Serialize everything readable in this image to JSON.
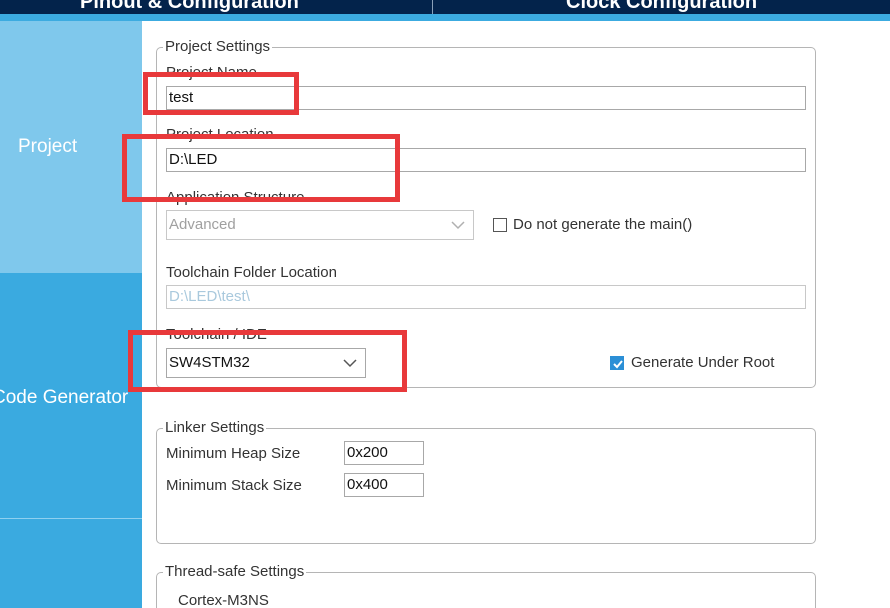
{
  "tabs": {
    "pinout": "Pinout & Configuration",
    "clock": "Clock Configuration"
  },
  "sidebar": {
    "items": [
      {
        "label": "Project"
      },
      {
        "label": "Code Generator"
      },
      {
        "label": ""
      }
    ]
  },
  "project_settings": {
    "legend": "Project Settings",
    "project_name": {
      "label": "Project Name",
      "value": "test"
    },
    "project_location": {
      "label": "Project Location",
      "value": "D:\\LED"
    },
    "application_structure": {
      "label": "Application Structure",
      "value": "Advanced"
    },
    "do_not_generate_main": {
      "label": "Do not generate the main()",
      "checked": false
    },
    "toolchain_folder": {
      "label": "Toolchain Folder Location",
      "value": "D:\\LED\\test\\"
    },
    "toolchain_ide": {
      "label": "Toolchain / IDE",
      "value": "SW4STM32"
    },
    "generate_under_root": {
      "label": "Generate Under Root",
      "checked": true
    }
  },
  "linker_settings": {
    "legend": "Linker Settings",
    "heap": {
      "label": "Minimum Heap Size",
      "value": "0x200"
    },
    "stack": {
      "label": "Minimum Stack Size",
      "value": "0x400"
    }
  },
  "thread_safe": {
    "legend": "Thread-safe Settings",
    "core": "Cortex-M3NS"
  },
  "colors": {
    "topbar": "#03234b",
    "accent": "#3cabe0",
    "sidebar": "#3aaae0",
    "sidebar_selected": "#7fc8ec",
    "annotation": "#e8393b"
  },
  "icons": {
    "dropdown": "chevron-down-icon",
    "checkbox_checked": "checkmark-icon"
  }
}
